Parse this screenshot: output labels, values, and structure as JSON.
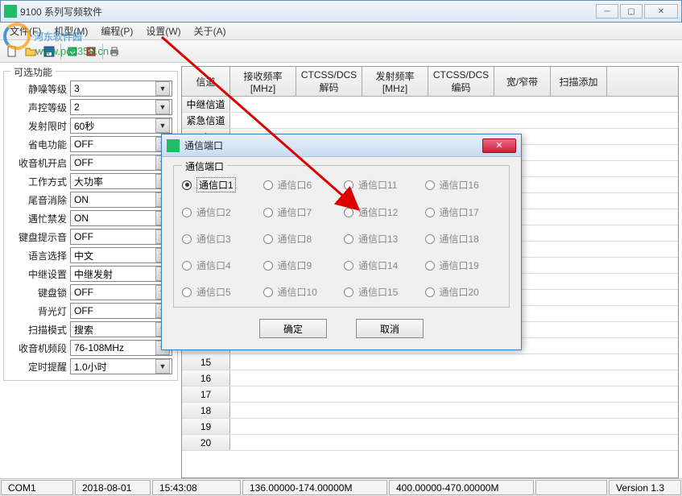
{
  "window": {
    "title": "9100 系列写频软件"
  },
  "menu": {
    "file": "文件(F)",
    "model": "机型(M)",
    "program": "编程(P)",
    "settings": "设置(W)",
    "about": "关于(A)"
  },
  "watermark": {
    "text": "河东软件园",
    "url": "www.pc0359.cn"
  },
  "left_group_title": "可选功能",
  "fields": {
    "squelch": {
      "label": "静噪等级",
      "value": "3"
    },
    "vox": {
      "label": "声控等级",
      "value": "2"
    },
    "tx_time": {
      "label": "发射限时",
      "value": "60秒"
    },
    "power_save": {
      "label": "省电功能",
      "value": "OFF"
    },
    "radio_on": {
      "label": "收音机开启",
      "value": "OFF"
    },
    "work_mode": {
      "label": "工作方式",
      "value": "大功率"
    },
    "tail_elim": {
      "label": "尾音消除",
      "value": "ON"
    },
    "busy_lock": {
      "label": "遇忙禁发",
      "value": "ON"
    },
    "key_beep": {
      "label": "键盘提示音",
      "value": "OFF"
    },
    "language": {
      "label": "语言选择",
      "value": "中文"
    },
    "repeater": {
      "label": "中继设置",
      "value": "中继发射"
    },
    "key_lock": {
      "label": "键盘锁",
      "value": "OFF"
    },
    "backlight": {
      "label": "背光灯",
      "value": "OFF"
    },
    "scan_mode": {
      "label": "扫描模式",
      "value": "搜索"
    },
    "fm_band": {
      "label": "收音机频段",
      "value": "76-108MHz"
    },
    "timer": {
      "label": "定时提醒",
      "value": "1.0小时"
    }
  },
  "grid": {
    "col0": "信道",
    "col1": "接收频率\n[MHz]",
    "col2": "CTCSS/DCS\n解码",
    "col3": "发射频率\n[MHz]",
    "col4": "CTCSS/DCS\n编码",
    "col5": "宽/窄带",
    "col6": "扫描添加",
    "row_repeater": "中继信道",
    "row_emergency": "紧急信道",
    "rows": [
      "15",
      "16",
      "17",
      "18",
      "19",
      "20"
    ]
  },
  "dialog": {
    "title": "通信端口",
    "group_title": "通信端口",
    "ports": [
      {
        "label": "通信口1",
        "enabled": true,
        "checked": true
      },
      {
        "label": "通信口6",
        "enabled": false,
        "checked": false
      },
      {
        "label": "通信口11",
        "enabled": false,
        "checked": false
      },
      {
        "label": "通信口16",
        "enabled": false,
        "checked": false
      },
      {
        "label": "通信口2",
        "enabled": false,
        "checked": false
      },
      {
        "label": "通信口7",
        "enabled": false,
        "checked": false
      },
      {
        "label": "通信口12",
        "enabled": false,
        "checked": false
      },
      {
        "label": "通信口17",
        "enabled": false,
        "checked": false
      },
      {
        "label": "通信口3",
        "enabled": false,
        "checked": false
      },
      {
        "label": "通信口8",
        "enabled": false,
        "checked": false
      },
      {
        "label": "通信口13",
        "enabled": false,
        "checked": false
      },
      {
        "label": "通信口18",
        "enabled": false,
        "checked": false
      },
      {
        "label": "通信口4",
        "enabled": false,
        "checked": false
      },
      {
        "label": "通信口9",
        "enabled": false,
        "checked": false
      },
      {
        "label": "通信口14",
        "enabled": false,
        "checked": false
      },
      {
        "label": "通信口19",
        "enabled": false,
        "checked": false
      },
      {
        "label": "通信口5",
        "enabled": false,
        "checked": false
      },
      {
        "label": "通信口10",
        "enabled": false,
        "checked": false
      },
      {
        "label": "通信口15",
        "enabled": false,
        "checked": false
      },
      {
        "label": "通信口20",
        "enabled": false,
        "checked": false
      }
    ],
    "ok": "确定",
    "cancel": "取消"
  },
  "status": {
    "com": "COM1",
    "date": "2018-08-01",
    "time": "15:43:08",
    "range1": "136.00000-174.00000M",
    "range2": "400.00000-470.00000M",
    "version": "Version 1.3"
  }
}
